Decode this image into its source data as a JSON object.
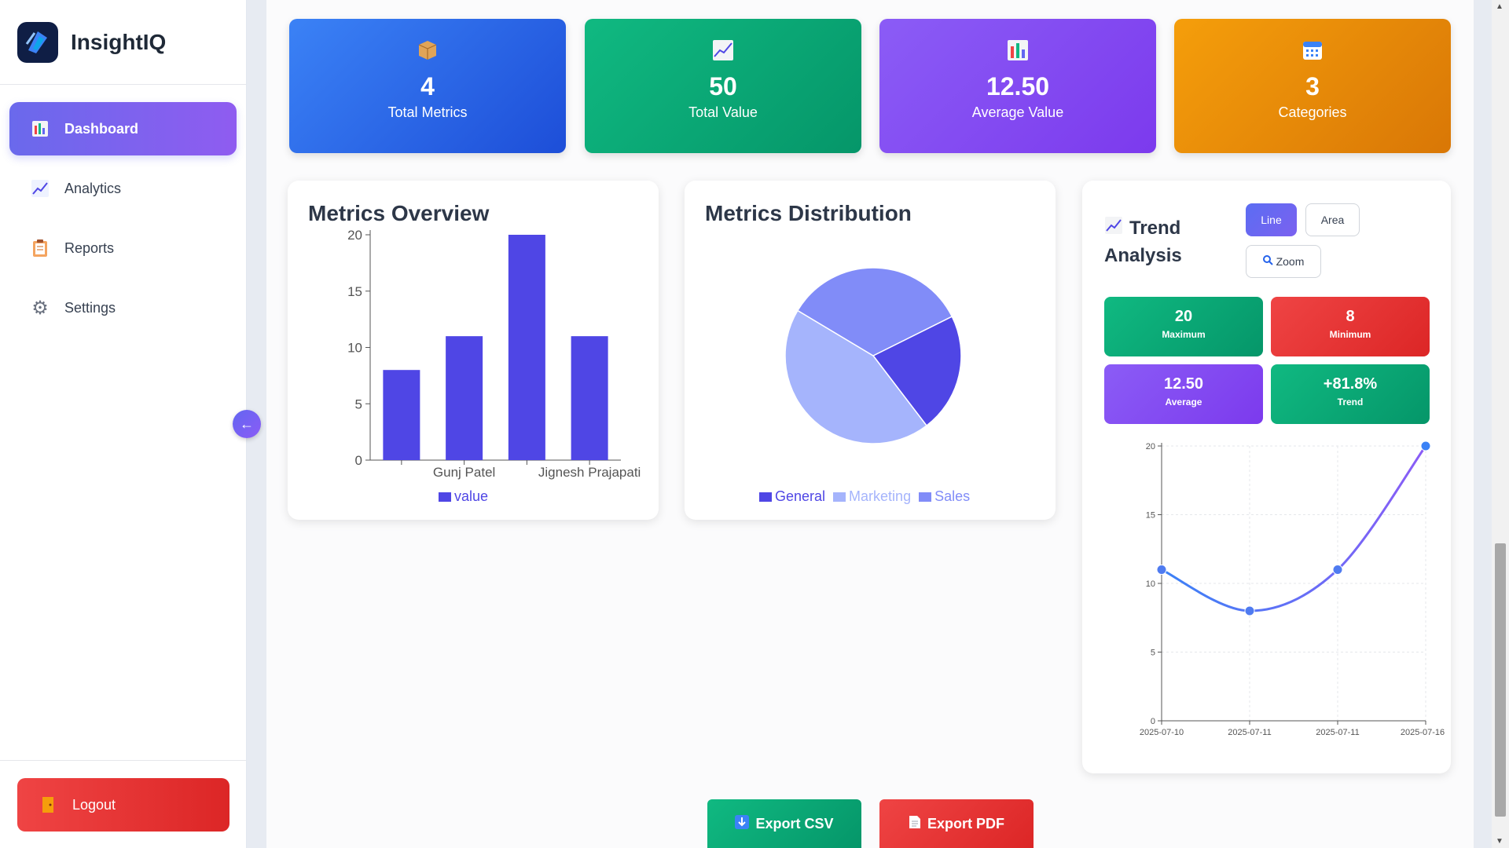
{
  "app": {
    "name": "InsightIQ"
  },
  "sidebar": {
    "items": [
      {
        "label": "Dashboard",
        "icon": "bar-chart-icon",
        "active": true
      },
      {
        "label": "Analytics",
        "icon": "line-chart-icon",
        "active": false
      },
      {
        "label": "Reports",
        "icon": "clipboard-icon",
        "active": false
      },
      {
        "label": "Settings",
        "icon": "gear-icon",
        "active": false
      }
    ],
    "logout_label": "Logout",
    "collapse_icon": "←"
  },
  "stats": [
    {
      "value": "4",
      "label": "Total Metrics",
      "icon": "package-icon",
      "color": "#2563eb"
    },
    {
      "value": "50",
      "label": "Total Value",
      "icon": "chart-up-icon",
      "color": "#10b981"
    },
    {
      "value": "12.50",
      "label": "Average Value",
      "icon": "bar-chart-icon",
      "color": "#8b5cf6"
    },
    {
      "value": "3",
      "label": "Categories",
      "icon": "calendar-icon",
      "color": "#f59e0b"
    }
  ],
  "overview": {
    "title": "Metrics Overview",
    "legend": "value"
  },
  "distribution": {
    "title": "Metrics Distribution",
    "legend": [
      "General",
      "Marketing",
      "Sales"
    ]
  },
  "trend": {
    "title_line1": "Trend",
    "title_line2": "Analysis",
    "buttons": {
      "line": "Line",
      "area": "Area",
      "zoom": "Zoom"
    },
    "stats": [
      {
        "value": "20",
        "label": "Maximum"
      },
      {
        "value": "8",
        "label": "Minimum"
      },
      {
        "value": "12.50",
        "label": "Average"
      },
      {
        "value": "+81.8%",
        "label": "Trend"
      }
    ]
  },
  "export": {
    "csv": "Export CSV",
    "pdf": "Export PDF"
  },
  "colors": {
    "accent": "#4f46e5",
    "primary": "#6366f1"
  },
  "chart_data": [
    {
      "type": "bar",
      "categories": [
        "",
        "Gunj Patel",
        "",
        "Jignesh Prajapati"
      ],
      "series": [
        {
          "name": "value",
          "values": [
            8,
            11,
            20,
            11
          ]
        }
      ],
      "ylim": [
        0,
        20
      ],
      "yticks": [
        0,
        5,
        10,
        15,
        20
      ]
    },
    {
      "type": "pie",
      "labels": [
        "General",
        "Marketing",
        "Sales"
      ],
      "values": [
        1,
        2,
        1.55
      ],
      "colors": [
        "#4f46e5",
        "#a5b4fc",
        "#818cf8"
      ]
    },
    {
      "type": "line",
      "x": [
        "2025-07-10",
        "2025-07-11",
        "2025-07-11",
        "2025-07-16"
      ],
      "values": [
        11,
        8,
        11,
        20
      ],
      "ylim": [
        0,
        20
      ],
      "yticks": [
        0,
        5,
        10,
        15,
        20
      ],
      "grid": true
    }
  ]
}
